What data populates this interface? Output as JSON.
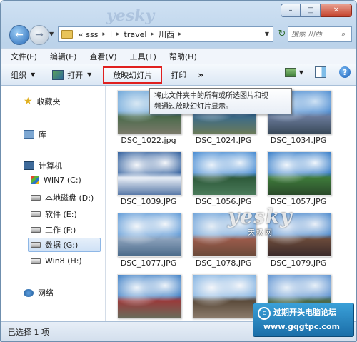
{
  "caption": {
    "minimize": "–",
    "maximize": "□",
    "close": "✕"
  },
  "address": {
    "crumbs": [
      "« sss",
      "l",
      "travel",
      "川西"
    ],
    "search_placeholder": "搜索 川西"
  },
  "menu": [
    "文件(F)",
    "编辑(E)",
    "查看(V)",
    "工具(T)",
    "帮助(H)"
  ],
  "toolbar": {
    "organize": "组织",
    "open": "打开",
    "slideshow": "放映幻灯片",
    "print": "打印",
    "more": "»"
  },
  "tooltip": {
    "line1": "将此文件夹中的所有或所选图片和视",
    "line2": "频通过放映幻灯片显示。"
  },
  "nav": {
    "favorites": "收藏夹",
    "libraries": "库",
    "computer": "计算机",
    "drives": [
      {
        "label": "WIN7 (C:)",
        "icon": "windows-drive-icon"
      },
      {
        "label": "本地磁盘 (D:)",
        "icon": "drive-icon"
      },
      {
        "label": "软件 (E:)",
        "icon": "drive-icon"
      },
      {
        "label": "工作 (F:)",
        "icon": "drive-icon"
      },
      {
        "label": "数据 (G:)",
        "icon": "drive-icon",
        "selected": true
      },
      {
        "label": "Win8 (H:)",
        "icon": "drive-icon"
      }
    ],
    "network": "网络"
  },
  "files": [
    {
      "name": "DSC_1022.jpg",
      "colors": [
        "#6aa4d8",
        "#d8e8f4",
        "#4a6a4a",
        "#7a7a6a"
      ]
    },
    {
      "name": "DSC_1024.JPG",
      "colors": [
        "#3a7fc8",
        "#eef4fa",
        "#3a6a8a",
        "#6a7a5a"
      ]
    },
    {
      "name": "DSC_1034.JPG",
      "colors": [
        "#4a8ad0",
        "#cfe2f4",
        "#6a7a9a",
        "#3a4a5a"
      ]
    },
    {
      "name": "DSC_1039.JPG",
      "colors": [
        "#2a5a9a",
        "#f4f6fa",
        "#e8eef6",
        "#5a7aa8"
      ]
    },
    {
      "name": "DSC_1056.JPG",
      "colors": [
        "#3f86d0",
        "#eaf2fa",
        "#2e5a3a",
        "#4a7a5a"
      ]
    },
    {
      "name": "DSC_1057.JPG",
      "colors": [
        "#2f78c6",
        "#f0f6fc",
        "#3e7a3a",
        "#2a4a2a"
      ]
    },
    {
      "name": "DSC_1077.JPG",
      "colors": [
        "#5c98d6",
        "#f2f6fa",
        "#8aa0ba",
        "#4a6a8a"
      ]
    },
    {
      "name": "DSC_1078.JPG",
      "colors": [
        "#6aa0d8",
        "#e6eef6",
        "#9a5a4a",
        "#6a4a3a"
      ]
    },
    {
      "name": "DSC_1079.JPG",
      "colors": [
        "#4a88cc",
        "#eaf0f8",
        "#6a4a3a",
        "#3a2a2a"
      ]
    },
    {
      "name": "",
      "colors": [
        "#3a7cc4",
        "#eef4fa",
        "#9a3a3a",
        "#6a6a5a"
      ]
    },
    {
      "name": "",
      "colors": [
        "#7aaee0",
        "#f4f6fa",
        "#5a4a3a",
        "#8a7a6a"
      ]
    },
    {
      "name": "",
      "colors": [
        "#5a90d0",
        "#e8f0f8",
        "#4a6a4a",
        "#6a5a4a"
      ]
    }
  ],
  "status": "已选择 1 项",
  "watermarks": {
    "yesky": "yesky",
    "yesky_sub": "天极网",
    "top": "yesky",
    "badge_line1": "过期开头电脑论坛",
    "badge_line2": "www.gqgtpc.com",
    "badge_mark": "c"
  }
}
